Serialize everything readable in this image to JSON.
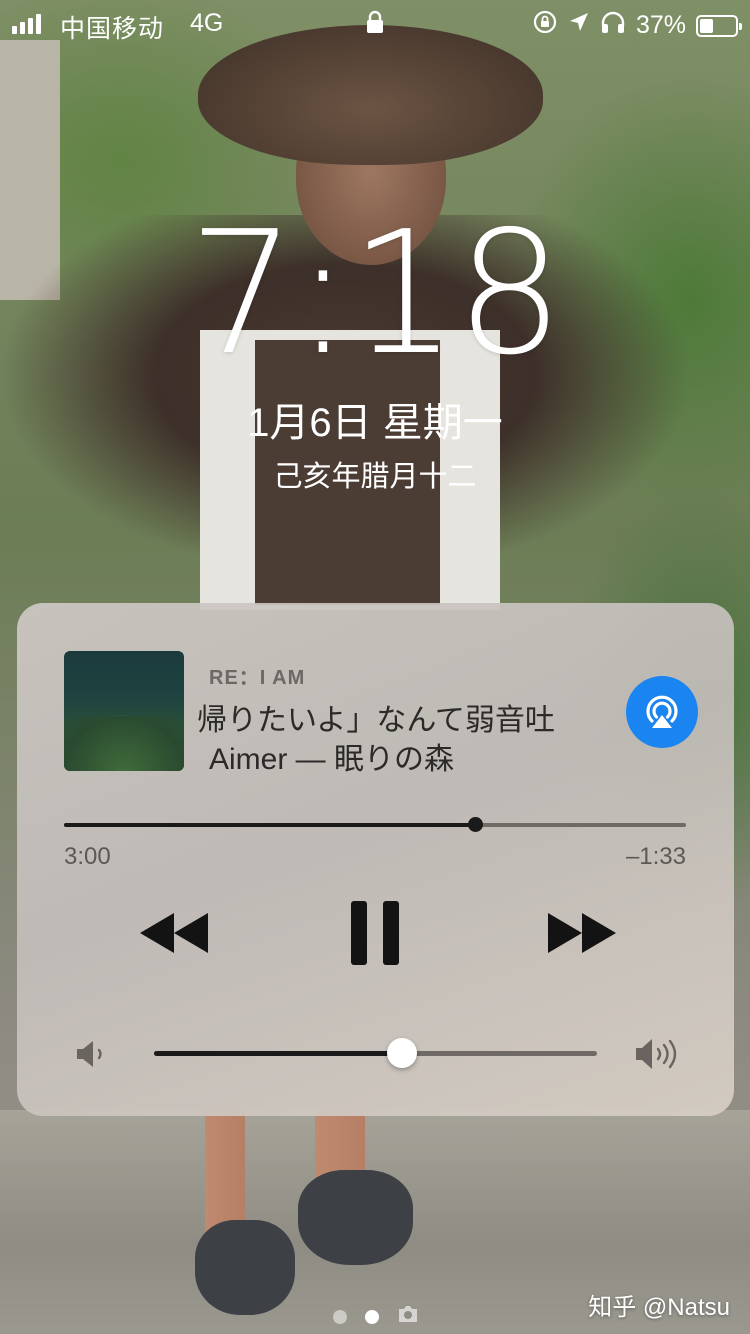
{
  "status_bar": {
    "carrier": "中国移动",
    "network": "4G",
    "battery": "37%",
    "battery_level": 0.37
  },
  "lock_screen": {
    "time": "7:18",
    "date": "1月6日 星期一",
    "lunar_date": "己亥年腊月十二"
  },
  "now_playing": {
    "header": "RE：I AM",
    "lyric": "帰りたいよ」なんて弱音吐",
    "artist_album": "Aimer — 眠りの森",
    "elapsed": "3:00",
    "remaining": "–1:33",
    "progress": 0.66,
    "volume": 0.56,
    "airplay_color": "#1a84f0"
  },
  "page_indicator": {
    "pages": 2,
    "current": 2,
    "camera": "camera-icon"
  },
  "watermark": "知乎 @Natsu"
}
